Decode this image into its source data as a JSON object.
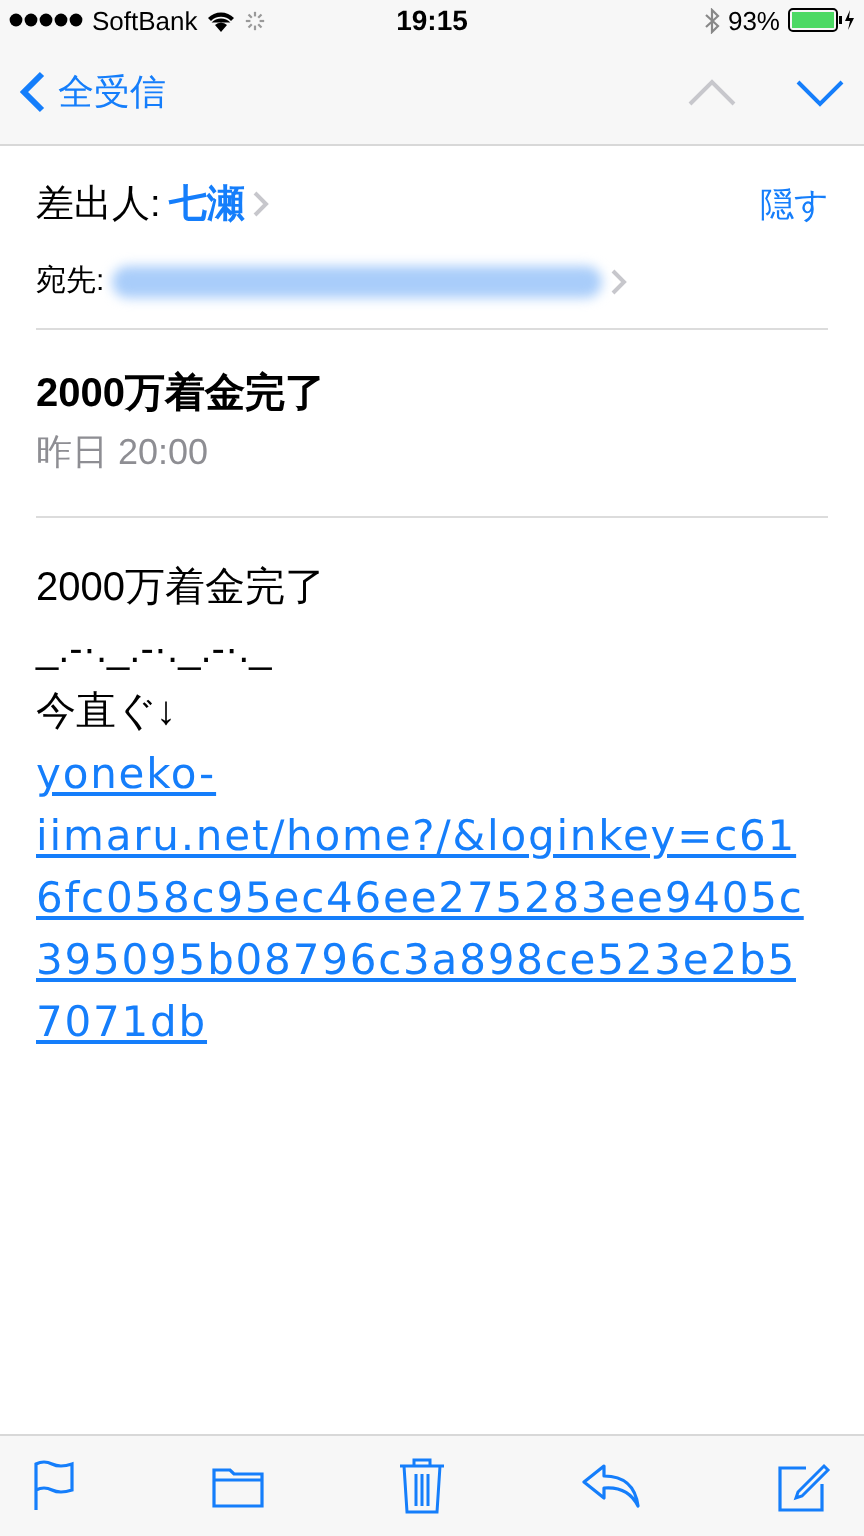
{
  "status_bar": {
    "carrier": "SoftBank",
    "time": "19:15",
    "battery": "93%"
  },
  "nav": {
    "back": "全受信",
    "arrows": [
      {
        "kind": "up",
        "disabled": true
      },
      {
        "kind": "down",
        "disabled": false
      }
    ]
  },
  "header": {
    "from_label": "差出人:",
    "from_name": "七瀬",
    "hide": "隠す",
    "to_label": "宛先:"
  },
  "subject": "2000万着金完了",
  "date": "昨日 20:00",
  "body": [
    {
      "kind": "text",
      "text": "2000万着金完了"
    },
    {
      "kind": "text",
      "text": "_.-·._.-·._.-·._"
    },
    {
      "kind": "text",
      "text": "今直ぐ↓"
    },
    {
      "kind": "link",
      "text": "yoneko-iimaru.net/home?/&loginkey=c616fc058c95ec46ee275283ee9405c395095b08796c3a898ce523e2b57071db"
    }
  ]
}
